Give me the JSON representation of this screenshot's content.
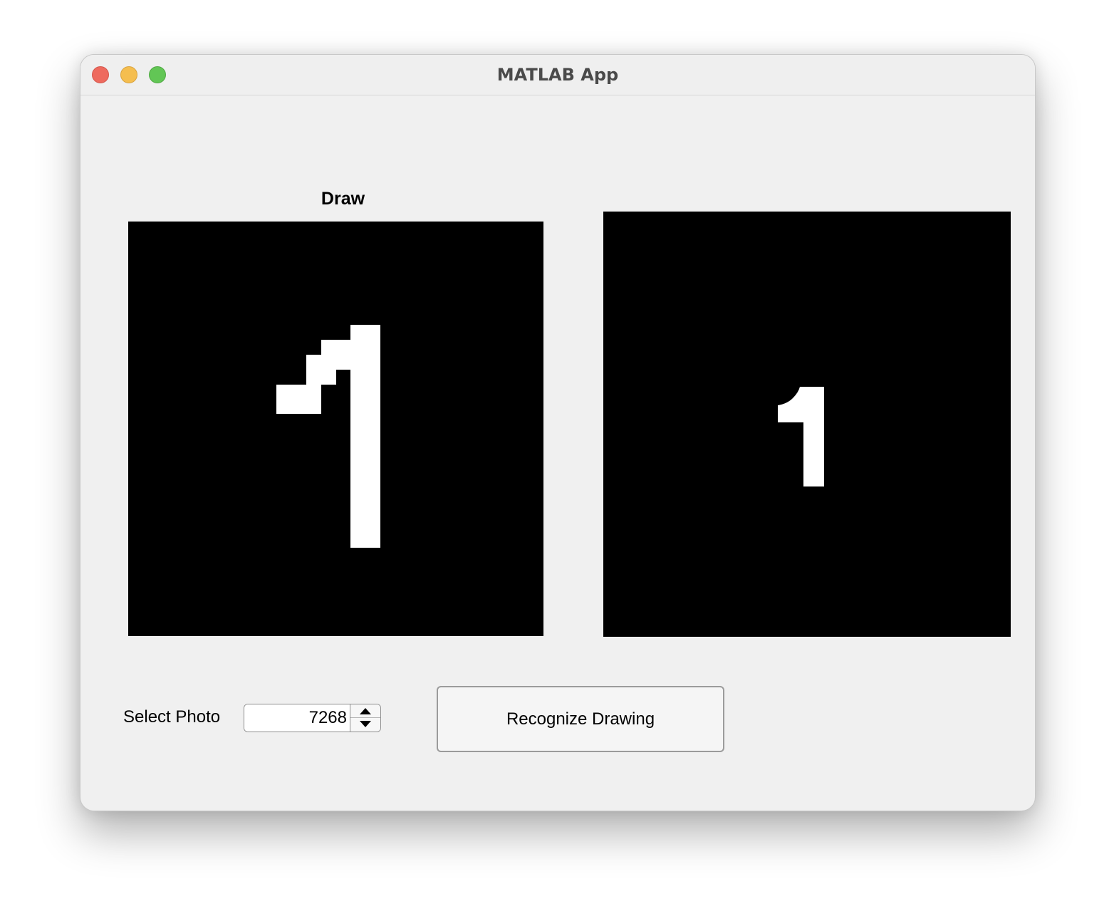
{
  "window": {
    "title": "MATLAB App"
  },
  "draw_panel": {
    "label": "Draw"
  },
  "result_panel": {
    "recognized_digit": "1"
  },
  "controls": {
    "select_photo_label": "Select Photo",
    "select_photo_value": "7268",
    "recognize_button_label": "Recognize Drawing"
  },
  "colors": {
    "canvas_background": "#000000",
    "stroke": "#ffffff",
    "window_background": "#f0f0f0",
    "close": "#ee6a5e",
    "minimize": "#f5be4f",
    "maximize": "#62c655"
  },
  "icons": [
    "close-icon",
    "minimize-icon",
    "maximize-icon",
    "chevron-up-icon",
    "chevron-down-icon"
  ]
}
